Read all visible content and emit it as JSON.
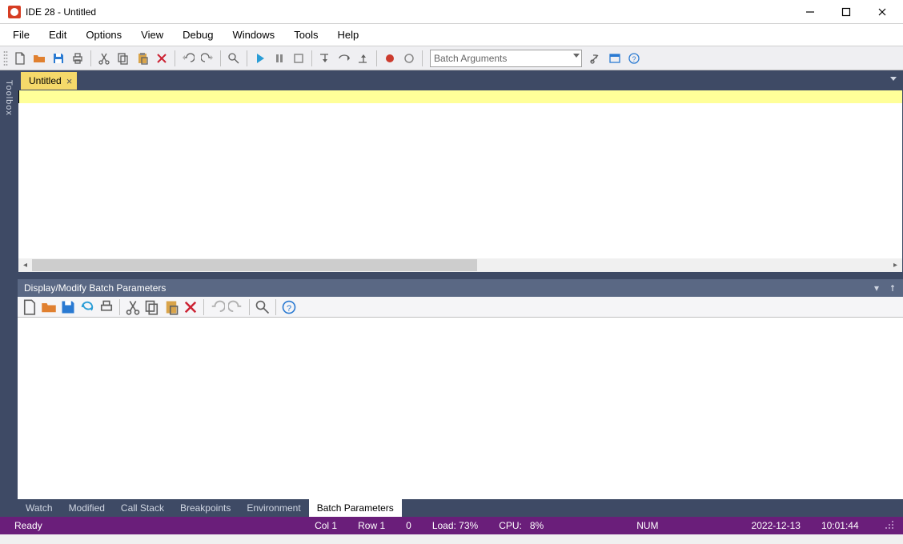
{
  "window": {
    "title": "IDE 28 - Untitled"
  },
  "menu": {
    "items": [
      "File",
      "Edit",
      "Options",
      "View",
      "Debug",
      "Windows",
      "Tools",
      "Help"
    ]
  },
  "toolbar": {
    "combo_placeholder": "Batch Arguments"
  },
  "sidebar": {
    "label": "Toolbox"
  },
  "doc_tabs": {
    "items": [
      {
        "label": "Untitled",
        "active": true
      }
    ]
  },
  "panel": {
    "title": "Display/Modify Batch Parameters"
  },
  "bottom_tabs": {
    "items": [
      "Watch",
      "Modified",
      "Call Stack",
      "Breakpoints",
      "Environment",
      "Batch Parameters"
    ],
    "active": "Batch Parameters"
  },
  "status": {
    "ready": "Ready",
    "col": "Col 1",
    "row": "Row 1",
    "zero": "0",
    "load": "Load: 73%",
    "cpu": "CPU:   8%",
    "num": "NUM",
    "date": "2022-12-13",
    "time": "10:01:44"
  }
}
